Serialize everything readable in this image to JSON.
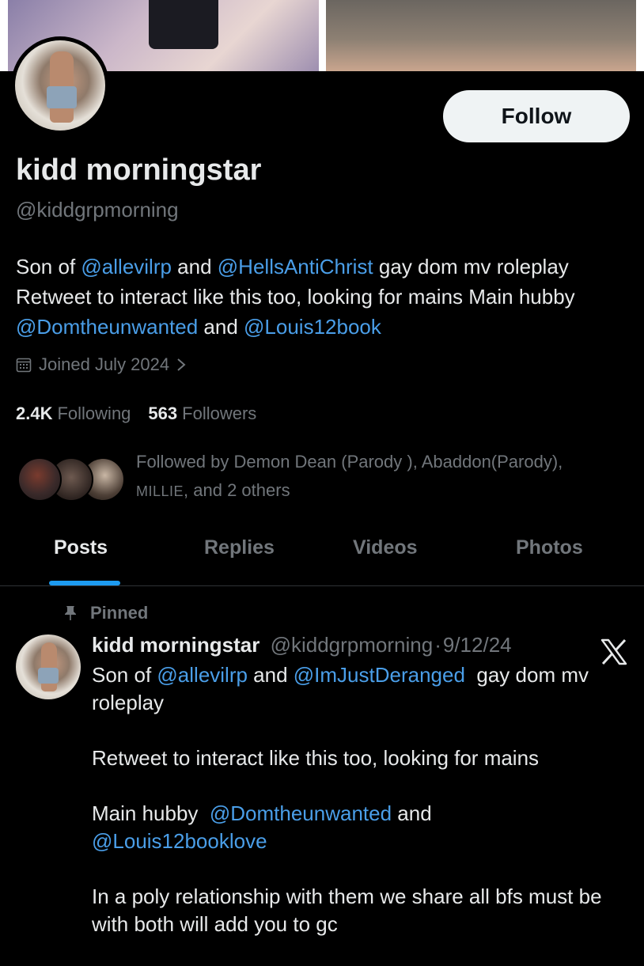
{
  "profile": {
    "display_name": "kidd morningstar",
    "handle": "@kiddgrpmorning",
    "follow_label": "Follow",
    "bio": {
      "t1": "Son of ",
      "m1": "@allevilrp",
      "t2": " and ",
      "m2": "@HellsAntiChrist",
      "t3": " gay dom mv roleplay Retweet to interact like this too, looking for mains Main hubby ",
      "m3": "@Domtheunwanted",
      "t4": " and ",
      "m4": "@Louis12book"
    },
    "joined": "Joined July 2024",
    "following_count": "2.4K",
    "following_label": "Following",
    "followers_count": "563",
    "followers_label": "Followers",
    "followed_by": {
      "line1": "Followed by Demon Dean (Parody ), Abaddon(Parody),",
      "millie": "MILLIE",
      "rest": ", and 2 others"
    }
  },
  "tabs": [
    {
      "label": "Posts",
      "active": true
    },
    {
      "label": "Replies",
      "active": false
    },
    {
      "label": "Videos",
      "active": false
    },
    {
      "label": "Photos",
      "active": false
    }
  ],
  "pinned_post": {
    "pinned_label": "Pinned",
    "author_name": "kidd morningstar",
    "author_handle": "@kiddgrpmorning",
    "separator": "·",
    "date": "9/12/24",
    "p1": {
      "t1": "Son of ",
      "m1": "@allevilrp",
      "t2": " and ",
      "m2": "@ImJustDeranged",
      "t3": "  gay dom mv roleplay"
    },
    "p2": "Retweet to interact like this too, looking for mains",
    "p3": {
      "t1": "Main hubby  ",
      "m1": "@Domtheunwanted",
      "t2": " and ",
      "m2": "@Louis12booklove"
    },
    "p4": "In a poly relationship with them we share all bfs must be with both will add you to gc"
  },
  "icons": {
    "calendar": "calendar-icon",
    "chevron": "chevron-right-icon",
    "pin": "pin-icon",
    "x_logo": "x-logo-icon"
  },
  "colors": {
    "background": "#000000",
    "text": "#e7e9ea",
    "secondary": "#71767b",
    "link": "#4a9ee8",
    "accent": "#1d9bf0",
    "follow_button": "#eff3f4"
  }
}
